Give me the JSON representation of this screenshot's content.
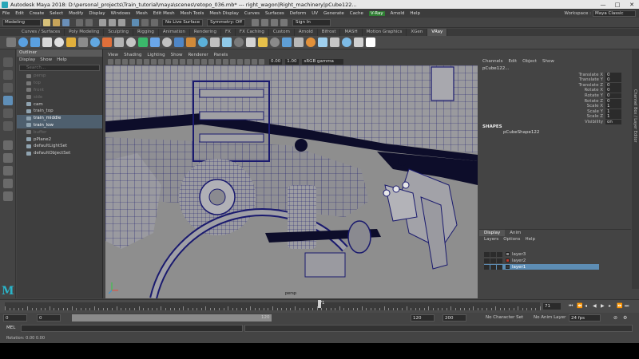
{
  "titlebar": {
    "title": "Autodesk Maya 2018: D:\\personal_projects\\Train_tutorial\\maya\\scenes\\retopo_036.mb*   ---   right_wagon|Right_machinery|pCube122...",
    "minimize": "—",
    "maximize": "□",
    "close": "✕"
  },
  "menubar": {
    "items": [
      "File",
      "Edit",
      "Create",
      "Select",
      "Modify",
      "Display",
      "Windows",
      "Mesh",
      "Edit Mesh",
      "Mesh Tools",
      "Mesh Display",
      "Curves",
      "Surfaces",
      "Deform",
      "UV",
      "Generate",
      "Cache",
      "V-Ray",
      "Arnold",
      "Help"
    ],
    "workspace_label": "Workspace :",
    "workspace_value": "Maya Classic"
  },
  "statusline": {
    "mode": "Modeling",
    "live_surface": "No Live Surface",
    "symmetry": "Symmetry: Off",
    "sign_in": "Sign In"
  },
  "shelf": {
    "tabs": [
      "Curves / Surfaces",
      "Poly Modeling",
      "Sculpting",
      "Rigging",
      "Animation",
      "Rendering",
      "FX",
      "FX Caching",
      "Custom",
      "Arnold",
      "Bifrost",
      "MASH",
      "Motion Graphics",
      "XGen",
      "VRay"
    ],
    "active_tab": "VRay",
    "icon_colors": [
      "#7a7a7a",
      "#5aa0e0",
      "#5aa0e0",
      "#d9d9d9",
      "#e0e0e0",
      "#e2b03c",
      "#8c8c8c",
      "#62a8e2",
      "#e06f3a",
      "#b3b3b3",
      "#c5c5c5",
      "#3bb86b",
      "#6aa6e8",
      "#c0c0c0",
      "#4f86c6",
      "#d08a3a",
      "#5bb0d8",
      "#bfbfbf",
      "#8fc9e8",
      "#7a7a7a",
      "#d3d3d3",
      "#e6c04a",
      "#8a8a8a",
      "#5f9fd6",
      "#b8b8b8",
      "#e2913a",
      "#9fd0ef",
      "#c6c6c6",
      "#7dbbe6",
      "#d0d0d0",
      "#ffffff"
    ]
  },
  "outliner": {
    "title": "Outliner",
    "menu": [
      "Display",
      "Show",
      "Help"
    ],
    "search_placeholder": "Search...",
    "items": [
      {
        "label": "persp",
        "state": "dim"
      },
      {
        "label": "top",
        "state": "dim"
      },
      {
        "label": "front",
        "state": "dim"
      },
      {
        "label": "side",
        "state": "dim"
      },
      {
        "label": "cam",
        "state": "normal"
      },
      {
        "label": "train_top",
        "state": "normal"
      },
      {
        "label": "train_middle",
        "state": "selected"
      },
      {
        "label": "train_low",
        "state": "selected"
      },
      {
        "label": "buffer",
        "state": "dim"
      },
      {
        "label": "pPlane2",
        "state": "normal"
      },
      {
        "label": "defaultLightSet",
        "state": "normal"
      },
      {
        "label": "defaultObjectSet",
        "state": "normal"
      }
    ]
  },
  "viewport": {
    "menu": [
      "View",
      "Shading",
      "Lighting",
      "Show",
      "Renderer",
      "Panels"
    ],
    "exposure": "0.00",
    "gamma": "1.00",
    "colorspace": "sRGB gamma",
    "camera_label": "persp"
  },
  "channelbox": {
    "menu": [
      "Channels",
      "Edit",
      "Object",
      "Show"
    ],
    "object_name": "pCube122...",
    "attributes": [
      {
        "name": "Translate X",
        "value": "0"
      },
      {
        "name": "Translate Y",
        "value": "0"
      },
      {
        "name": "Translate Z",
        "value": "0"
      },
      {
        "name": "Rotate X",
        "value": "0"
      },
      {
        "name": "Rotate Y",
        "value": "0"
      },
      {
        "name": "Rotate Z",
        "value": "0"
      },
      {
        "name": "Scale X",
        "value": "1"
      },
      {
        "name": "Scale Y",
        "value": "1"
      },
      {
        "name": "Scale Z",
        "value": "1"
      },
      {
        "name": "Visibility",
        "value": "on"
      }
    ],
    "shapes_heading": "SHAPES",
    "shape_name": "pCubeShape122",
    "side_tabs": "Channel Box / Layer Editor"
  },
  "layers": {
    "tabs": [
      "Display",
      "Anim"
    ],
    "menu": [
      "Layers",
      "Options",
      "Help"
    ],
    "rows": [
      {
        "name": "layer3",
        "color": "#8a8a8a",
        "selected": false
      },
      {
        "name": "layer2",
        "color": "#c0392b",
        "selected": false
      },
      {
        "name": "layer1",
        "color": "#3a3a3a",
        "selected": true
      }
    ]
  },
  "timeline": {
    "current_frame": "71",
    "current_field": "71"
  },
  "range": {
    "start": "0",
    "inner_start": "0",
    "inner_end": "120",
    "end_a": "120",
    "end_b": "200",
    "char_set": "No Character Set",
    "anim_layer": "No Anim Layer",
    "fps": "24 fps"
  },
  "cmdline": {
    "mel": "MEL"
  },
  "helpline": {
    "text": "Rotation:   0.00    0.00"
  },
  "colors": {
    "accent": "#5d8db4",
    "viewport_bg": "#8e8e8e",
    "wire": "#1a1a6e"
  }
}
